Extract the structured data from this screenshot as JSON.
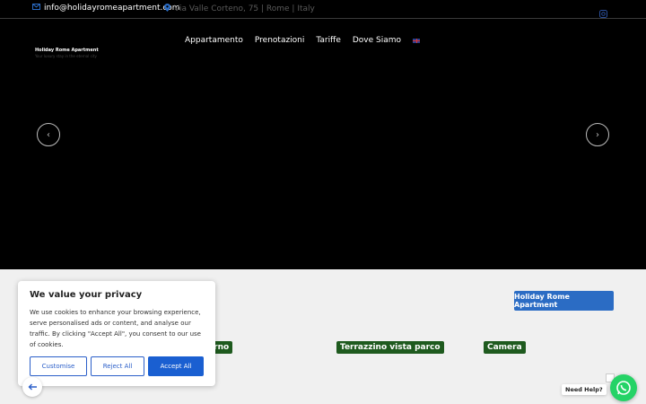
{
  "topbar": {
    "email": "info@holidayromeapartment.com",
    "address": "Via Valle Corteno, 75 | Rome | Italy",
    "social_icon": "instagram-icon"
  },
  "logo": {
    "title": "Holiday Rome Apartment",
    "subtitle": "Your luxury stay in the eternal city"
  },
  "nav": {
    "items": [
      "Appartamento",
      "Prenotazioni",
      "Tariffe",
      "Dove Siamo"
    ],
    "language_flag": "uk-flag-icon"
  },
  "slider": {
    "prev_icon": "chevron-left-icon",
    "next_icon": "chevron-right-icon",
    "prev": "‹",
    "next": "›"
  },
  "content": {
    "cta": "Holiday Rome Apartment",
    "labels": [
      "orno",
      "Terrazzino vista parco",
      "Camera"
    ]
  },
  "cookie": {
    "title": "We value your privacy",
    "text": "We use cookies to enhance your browsing experience, serve personalised ads or content, and analyse our traffic. By clicking \"Accept All\", you consent to our use of cookies.",
    "customise": "Customise",
    "reject": "Reject All",
    "accept": "Accept All"
  },
  "widgets": {
    "help": "Need Help?",
    "whatsapp_icon": "whatsapp-icon",
    "back_icon": "back-arrow-icon"
  },
  "colors": {
    "accent": "#2b6cc4",
    "label_bg": "#1e5a1e",
    "whatsapp": "#25d366"
  }
}
